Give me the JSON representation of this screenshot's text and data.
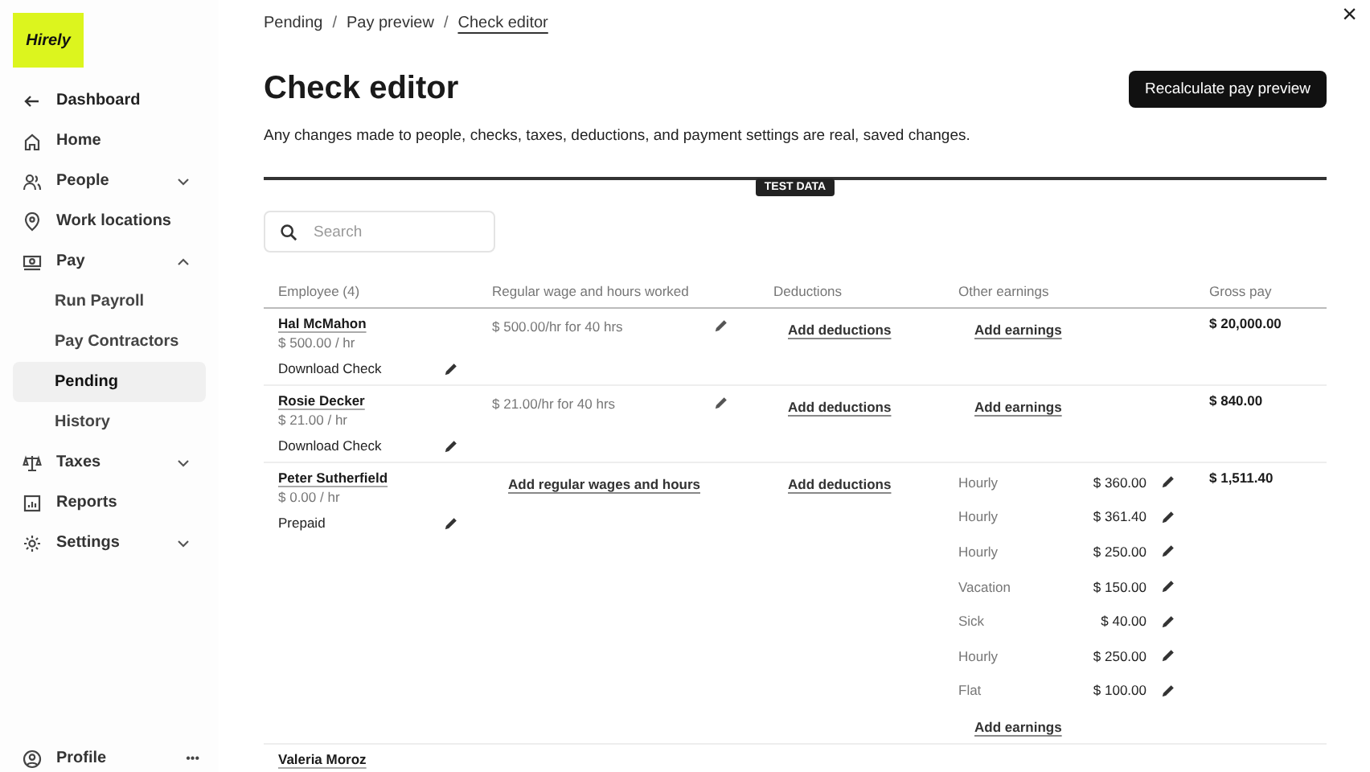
{
  "logo": "Hirely",
  "sidebar": {
    "back": "Dashboard",
    "items": [
      {
        "label": "Home",
        "kind": "link"
      },
      {
        "label": "People",
        "kind": "group",
        "expanded": false
      },
      {
        "label": "Work locations",
        "kind": "link"
      },
      {
        "label": "Pay",
        "kind": "group",
        "expanded": true,
        "children": [
          {
            "label": "Run Payroll",
            "selected": false
          },
          {
            "label": "Pay Contractors",
            "selected": false
          },
          {
            "label": "Pending",
            "selected": true
          },
          {
            "label": "History",
            "selected": false
          }
        ]
      },
      {
        "label": "Taxes",
        "kind": "group",
        "expanded": false
      },
      {
        "label": "Reports",
        "kind": "link"
      },
      {
        "label": "Settings",
        "kind": "group",
        "expanded": false
      }
    ],
    "profile": "Profile",
    "profile_more": "•••"
  },
  "breadcrumb": [
    "Pending",
    "Pay preview",
    "Check editor"
  ],
  "breadcrumb_separator": "/",
  "close": "×",
  "title": "Check editor",
  "description": "Any changes made to people, checks, taxes, deductions, and payment settings are real, saved changes.",
  "primary_button": "Recalculate pay preview",
  "badge": "TEST DATA",
  "search": {
    "placeholder": "Search"
  },
  "table": {
    "columns": [
      "Employee (4)",
      "Regular wage and hours worked",
      "Deductions",
      "Other earnings",
      "Gross pay"
    ],
    "rows": [
      {
        "name": "Hal McMahon",
        "rate": "$ 500.00 / hr",
        "action": "Download Check",
        "wage": {
          "kind": "value",
          "text": "$ 500.00/hr for 40 hrs"
        },
        "deductions": "Add deductions",
        "earnings_link": "Add earnings",
        "gross": "$ 20,000.00"
      },
      {
        "name": "Rosie Decker",
        "rate": "$ 21.00 / hr",
        "action": "Download Check",
        "wage": {
          "kind": "value",
          "text": "$ 21.00/hr for 40 hrs"
        },
        "deductions": "Add deductions",
        "earnings_link": "Add earnings",
        "gross": "$ 840.00"
      },
      {
        "name": "Peter Sutherfield",
        "rate": "$ 0.00 / hr",
        "action": "Prepaid",
        "wage": {
          "kind": "link",
          "text": "Add regular wages and hours"
        },
        "deductions": "Add deductions",
        "earnings": [
          {
            "type": "Hourly",
            "amount": "$ 360.00"
          },
          {
            "type": "Hourly",
            "amount": "$ 361.40"
          },
          {
            "type": "Hourly",
            "amount": "$ 250.00"
          },
          {
            "type": "Vacation",
            "amount": "$ 150.00"
          },
          {
            "type": "Sick",
            "amount": "$ 40.00"
          },
          {
            "type": "Hourly",
            "amount": "$ 250.00"
          },
          {
            "type": "Flat",
            "amount": "$ 100.00"
          }
        ],
        "earnings_link": "Add earnings",
        "gross": "$ 1,511.40"
      },
      {
        "name": "Valeria Moroz"
      }
    ]
  }
}
